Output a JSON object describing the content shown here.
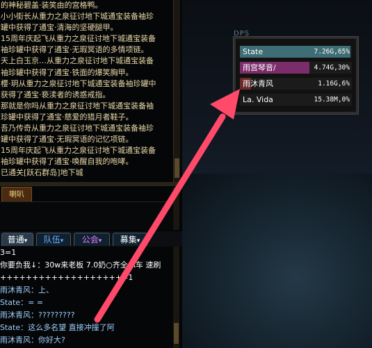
{
  "system_messages": [
    "的神秘碧盖·装笑由的宫格鸭。",
    "小小街长从重力之泉征讨地下城通宝装备袖珍",
    "罐中获得了通宝·清海的坚硬腿甲。",
    "15周年庆起飞从重力之泉征讨地下城通宝装备",
    "袖珍罐中获得了通宝·无瑕冥语的多情项链。",
    "天上白玉京…从重力之泉征讨地下城通宝装备",
    "袖珍罐中获得了通宝·铁面的爆笑胸甲。",
    "樱·玥从重力之泉征讨地下城通宝装备袖珍罐中",
    "获得了通宝·亵渎者的诱惑戒指。",
    "那就是你吗从重力之泉征讨地下城通宝装备袖",
    "珍罐中获得了通宝·慈爱的猎月者鞋子。",
    "吾乃传奇从重力之泉征讨地下城通宝装备袖珍",
    "罐中获得了通宝·无瑕冥语的记忆项链。",
    "15周年庆起飞从重力之泉征讨地下城通宝装备",
    "袖珍罐中获得了通宝·唤醒自我的咆哮。",
    "已通关[跃石群岛]地下城"
  ],
  "tabs": {
    "laba": "喇叭"
  },
  "channels": [
    {
      "label": "普通",
      "arrow": "▾",
      "color": "#ffffff"
    },
    {
      "label": "队伍",
      "arrow": "▾",
      "color": "#6ab0ff"
    },
    {
      "label": "公会",
      "arrow": "▾",
      "color": "#e080ff"
    },
    {
      "label": "募集",
      "arrow": "▾",
      "color": "#ffffff"
    }
  ],
  "chat": [
    {
      "text": "                3=1",
      "color": "#ffffff"
    },
    {
      "text": "你要负我↓：30w来老板 7.0奶○齐全 A车 速刷",
      "color": "#ffffff"
    },
    {
      "text": "       +++++++++++++++++++=1",
      "color": "#ffffff"
    },
    {
      "text": "雨沐青风：上、",
      "color": "#9fd0ff"
    },
    {
      "text": " State：= =",
      "color": "#9fd0ff"
    },
    {
      "text": "雨沐青风：?????????",
      "color": "#9fd0ff"
    },
    {
      "text": " State：这么多名望 直接冲撞了阿",
      "color": "#9fd0ff"
    },
    {
      "text": "雨沐青风：你好大?",
      "color": "#9fd0ff"
    }
  ],
  "dps": {
    "title": "DPS",
    "rows": [
      {
        "name": "State",
        "value": "7.26G,65%",
        "share": 0.99,
        "fill": "#3f6d75",
        "text_color": "#ffffff"
      },
      {
        "name": "雨宫琴音/",
        "value": "4.74G,30%",
        "share": 0.62,
        "fill": "#7b2d6b",
        "text_color": "#ffffff"
      },
      {
        "name": "雨沐青风",
        "value": "1.16G,6%",
        "share": 0.1,
        "fill": "#6a2a2a",
        "text_color": "#ffffff"
      },
      {
        "name": "La. Vida",
        "value": "15.38M,0%",
        "share": 0.0,
        "fill": "#5a2420",
        "text_color": "#ffffff"
      }
    ]
  },
  "colors": {
    "annotation_arrow": "#ff4a6a"
  }
}
